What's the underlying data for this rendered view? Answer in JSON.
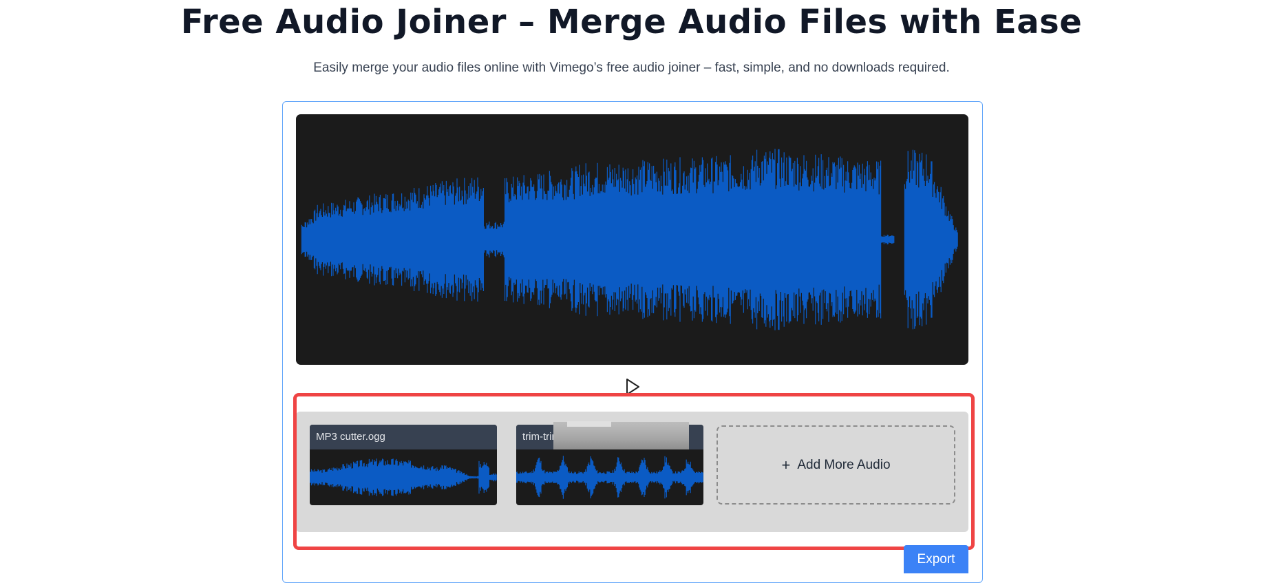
{
  "page": {
    "title": "Free Audio Joiner – Merge Audio Files with Ease",
    "subtitle": "Easily merge your audio files online with Vimego’s free audio joiner – fast, simple, and no downloads required."
  },
  "player": {
    "play_icon": "play-icon"
  },
  "clips": [
    {
      "name": "MP3 cutter.ogg"
    },
    {
      "name": "trim-trir"
    }
  ],
  "add_more": {
    "label": "Add More Audio",
    "icon": "plus-icon"
  },
  "export": {
    "label": "Export"
  },
  "colors": {
    "accent": "#3b82f6",
    "waveform": "#0b5bc4",
    "highlight": "#ef4444",
    "wave_bg": "#1b1b1b"
  }
}
